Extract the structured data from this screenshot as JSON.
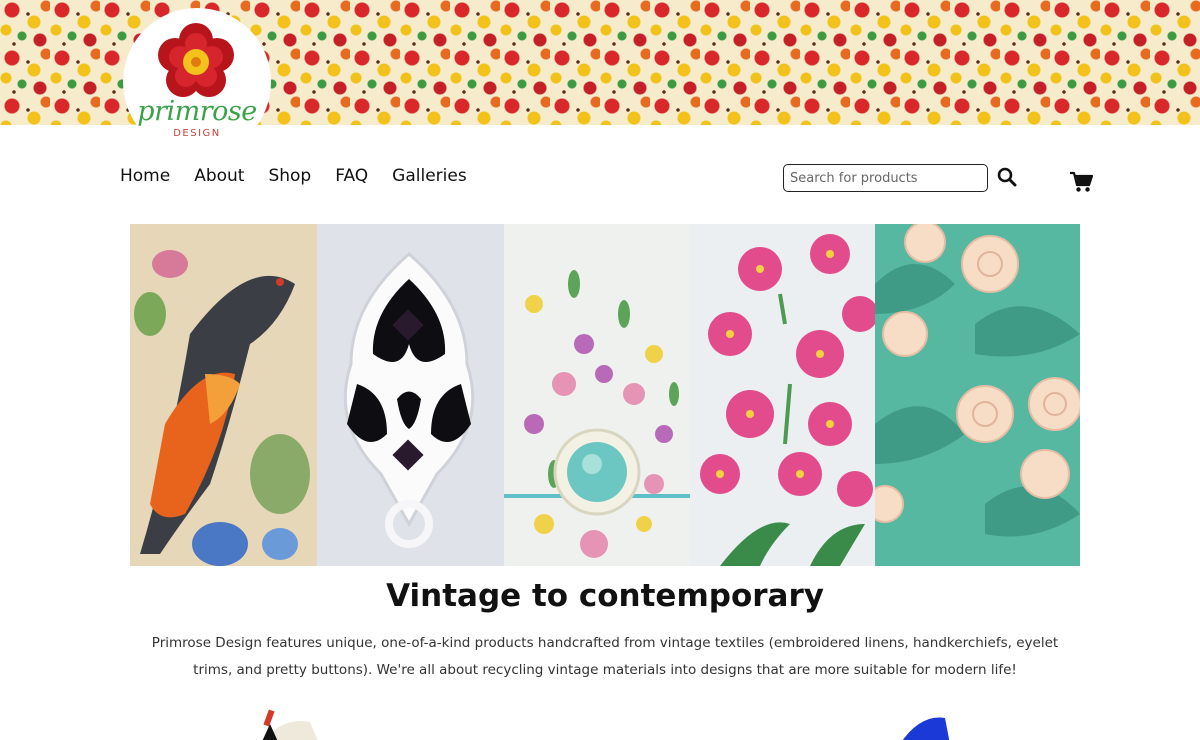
{
  "brand": {
    "name": "primrose",
    "sub": "DESIGN",
    "logo_icon": "primrose-flower-icon"
  },
  "nav": {
    "items": [
      {
        "label": "Home"
      },
      {
        "label": "About"
      },
      {
        "label": "Shop"
      },
      {
        "label": "FAQ"
      },
      {
        "label": "Galleries"
      }
    ]
  },
  "search": {
    "placeholder": "Search for products",
    "value": "",
    "icon": "search-icon"
  },
  "cart": {
    "icon": "cart-icon"
  },
  "hero": {
    "panels": [
      {
        "subject": "needlepoint-bird"
      },
      {
        "subject": "eyelet-lace-buttons"
      },
      {
        "subject": "floral-hanky-button"
      },
      {
        "subject": "embroidered-pink-flowers"
      },
      {
        "subject": "ribbon-roses"
      }
    ]
  },
  "main": {
    "headline": "Vintage to contemporary",
    "intro": "Primrose Design features unique, one-of-a-kind products handcrafted from vintage textiles (embroidered linens, handkerchiefs, eyelet trims, and pretty buttons). We're all about recycling vintage materials into designs that are more suitable for modern life!"
  },
  "colors": {
    "accent_green": "#3aa34a",
    "logo_red": "#c51f27",
    "text": "#111111"
  }
}
